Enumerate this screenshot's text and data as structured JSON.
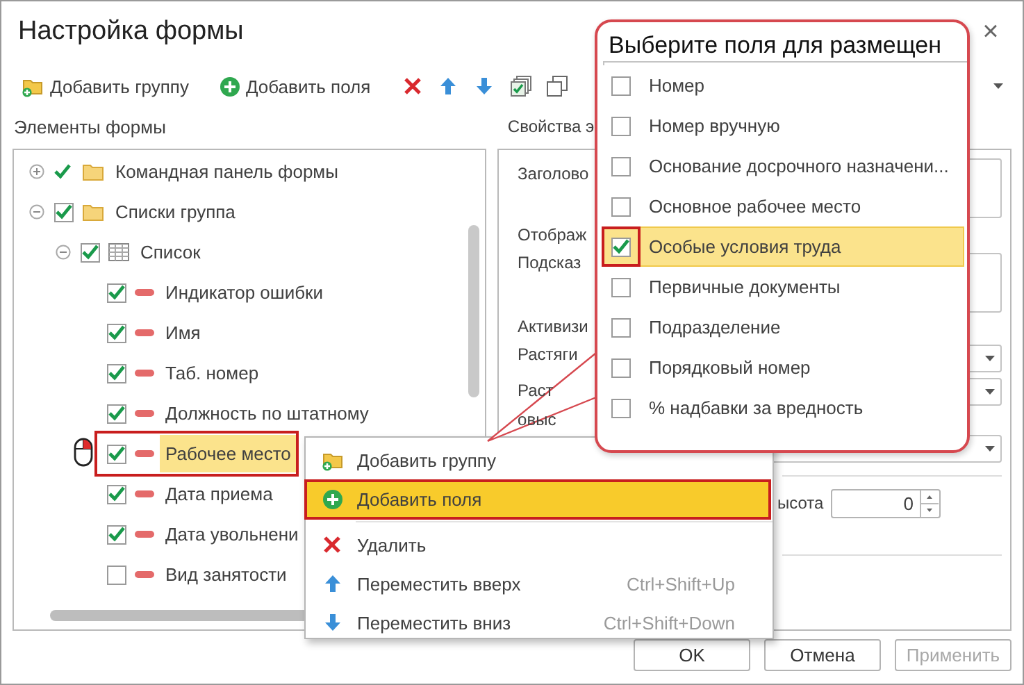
{
  "window": {
    "title": "Настройка формы",
    "close": "×"
  },
  "toolbar": {
    "buttons": [
      {
        "label": "Добавить группу"
      },
      {
        "label": "Добавить поля"
      }
    ]
  },
  "left_panel": {
    "title": "Элементы формы"
  },
  "right_panel": {
    "title": "Свойства э"
  },
  "tree": [
    {
      "label": "Командная панель формы",
      "kind": "panel",
      "checked": true,
      "expanded": false,
      "selected": false
    },
    {
      "label": "Списки группа",
      "kind": "group",
      "checked": true,
      "expanded": true,
      "selected": false,
      "children": [
        {
          "label": "Список",
          "kind": "table",
          "checked": true,
          "expanded": true,
          "selected": false,
          "children": [
            {
              "label": "Индикатор ошибки",
              "kind": "field",
              "checked": true,
              "selected": false
            },
            {
              "label": "Имя",
              "kind": "field",
              "checked": true,
              "selected": false
            },
            {
              "label": "Таб. номер",
              "kind": "field",
              "checked": true,
              "selected": false
            },
            {
              "label": "Должность по штатному",
              "kind": "field",
              "checked": true,
              "selected": false
            },
            {
              "label": "Рабочее место",
              "kind": "field",
              "checked": true,
              "selected": true
            },
            {
              "label": "Дата приема",
              "kind": "field",
              "checked": true,
              "selected": false
            },
            {
              "label": "Дата увольнени",
              "kind": "field",
              "checked": true,
              "selected": false
            },
            {
              "label": "Вид занятости",
              "kind": "field",
              "checked": false,
              "selected": false
            }
          ]
        }
      ]
    }
  ],
  "properties": [
    {
      "label": "Заголово",
      "kind": "textarea"
    },
    {
      "label": "Отображ",
      "kind": "label"
    },
    {
      "label": "Подсказ",
      "kind": "textarea"
    },
    {
      "label": "Активизи",
      "kind": "label"
    },
    {
      "label": "Растяги",
      "kind": "dropdown"
    },
    {
      "label": "Раст",
      "kind": "dropdown"
    },
    {
      "label": "овыс",
      "kind": "dropdown"
    },
    {
      "label": "ысота",
      "kind": "spin",
      "value": "0"
    }
  ],
  "context_menu": [
    {
      "label": "Добавить группу",
      "selected": false
    },
    {
      "label": "Добавить поля",
      "selected": true
    },
    {
      "label": "Удалить",
      "selected": false
    },
    {
      "label": "Переместить вверх",
      "shortcut": "Ctrl+Shift+Up",
      "selected": false
    },
    {
      "label": "Переместить вниз",
      "shortcut": "Ctrl+Shift+Down",
      "selected": false
    }
  ],
  "field_picker": {
    "title": "Выберите поля для размещен",
    "items": [
      {
        "label": "Номер",
        "checked": false,
        "selected": false
      },
      {
        "label": "Номер вручную",
        "checked": false,
        "selected": false
      },
      {
        "label": "Основание досрочного назначени...",
        "checked": false,
        "selected": false
      },
      {
        "label": "Основное рабочее место",
        "checked": false,
        "selected": false
      },
      {
        "label": "Особые условия труда",
        "checked": true,
        "selected": true
      },
      {
        "label": "Первичные документы",
        "checked": false,
        "selected": false
      },
      {
        "label": "Подразделение",
        "checked": false,
        "selected": false
      },
      {
        "label": "Порядковый номер",
        "checked": false,
        "selected": false
      },
      {
        "label": "% надбавки за вредность",
        "checked": false,
        "selected": false
      }
    ]
  },
  "buttons": [
    {
      "label": "OK",
      "disabled": false
    },
    {
      "label": "Отмена",
      "disabled": false
    },
    {
      "label": "Применить",
      "disabled": true
    }
  ]
}
